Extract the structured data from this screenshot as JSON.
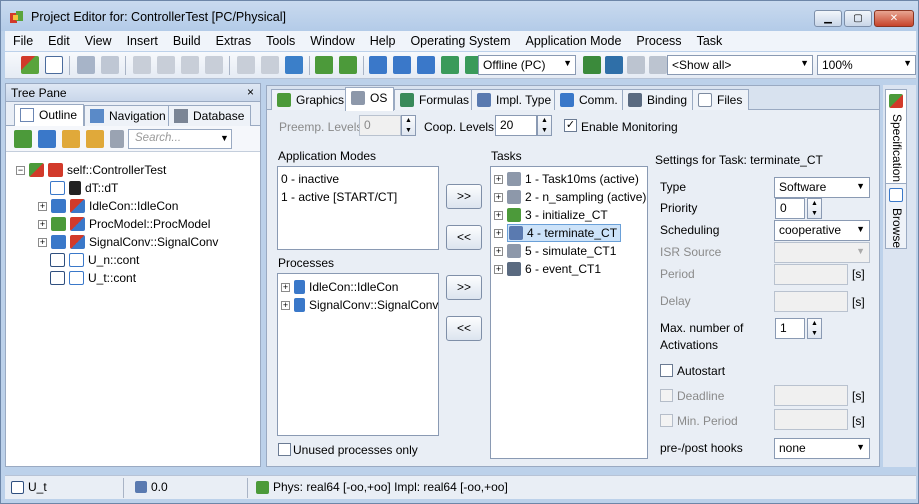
{
  "window": {
    "title": "Project Editor for: ControllerTest [PC/Physical]",
    "controls": {
      "minimize": "▁",
      "maximize": "▢",
      "close": "✕"
    }
  },
  "menu": [
    "File",
    "Edit",
    "View",
    "Insert",
    "Build",
    "Extras",
    "Tools",
    "Window",
    "Help",
    "Operating System",
    "Application Mode",
    "Process",
    "Task"
  ],
  "toolbar": {
    "platform_select": "Offline (PC)",
    "filter_select": "<Show all>",
    "zoom_select": "100%"
  },
  "tree_pane": {
    "title": "Tree Pane",
    "close": "×",
    "tabs": [
      "Outline",
      "Navigation",
      "Database"
    ],
    "search_placeholder": "Search...",
    "nodes": [
      {
        "label": "self::ControllerTest",
        "icon": "project-icon",
        "expander": "−"
      },
      {
        "label": "dT::dT",
        "icon": "parameter-icon",
        "expander": ""
      },
      {
        "label": "IdleCon::IdleCon",
        "icon": "component-icon",
        "expander": "+"
      },
      {
        "label": "ProcModel::ProcModel",
        "icon": "component-icon",
        "expander": "+"
      },
      {
        "label": "SignalConv::SignalConv",
        "icon": "component-icon",
        "expander": "+"
      },
      {
        "label": "U_n::cont",
        "icon": "message-icon",
        "expander": ""
      },
      {
        "label": "U_t::cont",
        "icon": "message-icon",
        "expander": ""
      }
    ]
  },
  "editor": {
    "tabs": [
      "Graphics",
      "OS",
      "Formulas",
      "Impl. Type",
      "Comm.",
      "Binding",
      "Files"
    ],
    "preemp_label": "Preemp. Levels",
    "preemp_value": "0",
    "coop_label": "Coop. Levels",
    "coop_value": "20",
    "enable_monitoring": "Enable Monitoring",
    "app_modes_label": "Application Modes",
    "app_modes": [
      "0 - inactive",
      "1 - active [START/CT]"
    ],
    "processes_label": "Processes",
    "processes": [
      "IdleCon::IdleCon",
      "SignalConv::SignalConv"
    ],
    "move_right": ">>",
    "move_left": "<<",
    "tasks_label": "Tasks",
    "tasks": [
      "1 - Task10ms (active)",
      "2 - n_sampling (active)",
      "3 - initialize_CT",
      "4 - terminate_CT",
      "5 - simulate_CT1",
      "6 - event_CT1"
    ],
    "unused_processes": "Unused processes only",
    "settings_title": "Settings for Task: terminate_CT",
    "settings": {
      "type_label": "Type",
      "type_value": "Software",
      "priority_label": "Priority",
      "priority_value": "0",
      "scheduling_label": "Scheduling",
      "scheduling_value": "cooperative",
      "isr_label": "ISR Source",
      "period_label": "Period",
      "delay_label": "Delay",
      "unit_s": "[s]",
      "max_act_label_1": "Max. number of",
      "max_act_label_2": "Activations",
      "max_act_value": "1",
      "autostart": "Autostart",
      "deadline": "Deadline",
      "min_period": "Min. Period",
      "hooks_label": "pre-/post hooks",
      "hooks_value": "none"
    }
  },
  "side_tabs": [
    "Specification",
    "Browse"
  ],
  "status": {
    "item": "U_t",
    "value": "0.0",
    "types": "Phys: real64 [-oo,+oo] Impl: real64 [-oo,+oo]"
  },
  "colors": {
    "accent": "#3a78c9",
    "selection": "#cde3f9",
    "frame": "#bcd1ea"
  }
}
